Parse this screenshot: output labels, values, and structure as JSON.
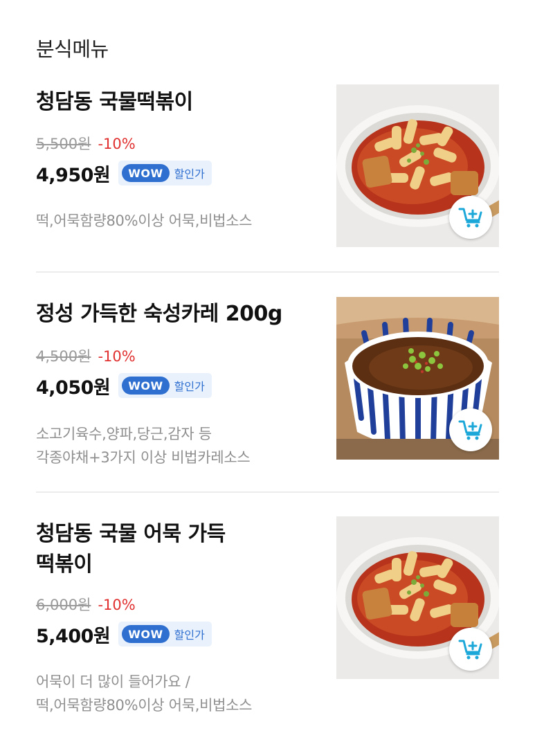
{
  "section": {
    "title": "분식메뉴"
  },
  "items": [
    {
      "name": "청담동 국물떡볶이",
      "original_price": "5,500원",
      "discount": "-10%",
      "price": "4,950원",
      "wow_label": "WOW",
      "wow_text": "할인가",
      "description_lines": [
        "떡,어묵함량80%이상 어묵,비법소스"
      ],
      "image": "tteokbokki-bowl",
      "cart_icon": "add-to-cart-icon"
    },
    {
      "name": "정성 가득한 숙성카레 200g",
      "original_price": "4,500원",
      "discount": "-10%",
      "price": "4,050원",
      "wow_label": "WOW",
      "wow_text": "할인가",
      "description_lines": [
        "소고기육수,양파,당근,감자 등",
        "각종야채+3가지 이상 비법카레소스"
      ],
      "image": "curry-udon-bowl",
      "cart_icon": "add-to-cart-icon"
    },
    {
      "name_lines": [
        "청담동 국물 어묵 가득",
        "떡볶이"
      ],
      "original_price": "6,000원",
      "discount": "-10%",
      "price": "5,400원",
      "wow_label": "WOW",
      "wow_text": "할인가",
      "description_lines": [
        "어묵이 더 많이 들어가요 /",
        "떡,어묵함량80%이상 어묵,비법소스"
      ],
      "image": "tteokbokki-bowl",
      "cart_icon": "add-to-cart-icon"
    }
  ],
  "colors": {
    "discount": "#e0302f",
    "wow_blue": "#2f6fd0",
    "wow_bg": "#e8f1fc",
    "cart_icon": "#1ca7d9"
  }
}
